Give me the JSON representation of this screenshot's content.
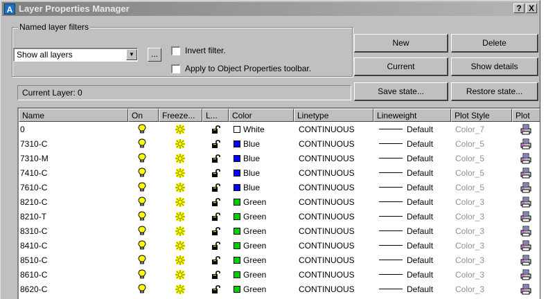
{
  "window": {
    "title": "Layer Properties Manager",
    "help_label": "?",
    "close_label": "X",
    "app_icon_label": "A"
  },
  "filters": {
    "group_label": "Named layer filters",
    "selected": "Show all layers",
    "browse_label": "...",
    "invert_label": "Invert filter.",
    "invert_checked": false,
    "apply_label": "Apply to Object Properties toolbar.",
    "apply_checked": false
  },
  "buttons": {
    "new": "New",
    "delete": "Delete",
    "current": "Current",
    "show_details": "Show details",
    "save_state": "Save state...",
    "restore_state": "Restore state..."
  },
  "current_layer": "Current Layer:  0",
  "columns": [
    "Name",
    "On",
    "Freeze...",
    "L...",
    "Color",
    "Linetype",
    "Lineweight",
    "Plot Style",
    "Plot"
  ],
  "colors": {
    "White": "#ffffff",
    "Blue": "#0000ff",
    "Green": "#00cc00"
  },
  "layers": [
    {
      "name": "0",
      "color": "White",
      "linetype": "CONTINUOUS",
      "lineweight": "Default",
      "plot_style": "Color_7"
    },
    {
      "name": "7310-C",
      "color": "Blue",
      "linetype": "CONTINUOUS",
      "lineweight": "Default",
      "plot_style": "Color_5"
    },
    {
      "name": "7310-M",
      "color": "Blue",
      "linetype": "CONTINUOUS",
      "lineweight": "Default",
      "plot_style": "Color_5"
    },
    {
      "name": "7410-C",
      "color": "Blue",
      "linetype": "CONTINUOUS",
      "lineweight": "Default",
      "plot_style": "Color_5"
    },
    {
      "name": "7610-C",
      "color": "Blue",
      "linetype": "CONTINUOUS",
      "lineweight": "Default",
      "plot_style": "Color_5"
    },
    {
      "name": "8210-C",
      "color": "Green",
      "linetype": "CONTINUOUS",
      "lineweight": "Default",
      "plot_style": "Color_3"
    },
    {
      "name": "8210-T",
      "color": "Green",
      "linetype": "CONTINUOUS",
      "lineweight": "Default",
      "plot_style": "Color_3"
    },
    {
      "name": "8310-C",
      "color": "Green",
      "linetype": "CONTINUOUS",
      "lineweight": "Default",
      "plot_style": "Color_3"
    },
    {
      "name": "8410-C",
      "color": "Green",
      "linetype": "CONTINUOUS",
      "lineweight": "Default",
      "plot_style": "Color_3"
    },
    {
      "name": "8510-C",
      "color": "Green",
      "linetype": "CONTINUOUS",
      "lineweight": "Default",
      "plot_style": "Color_3"
    },
    {
      "name": "8610-C",
      "color": "Green",
      "linetype": "CONTINUOUS",
      "lineweight": "Default",
      "plot_style": "Color_3"
    },
    {
      "name": "8620-C",
      "color": "Green",
      "linetype": "CONTINUOUS",
      "lineweight": "Default",
      "plot_style": "Color_3"
    }
  ]
}
